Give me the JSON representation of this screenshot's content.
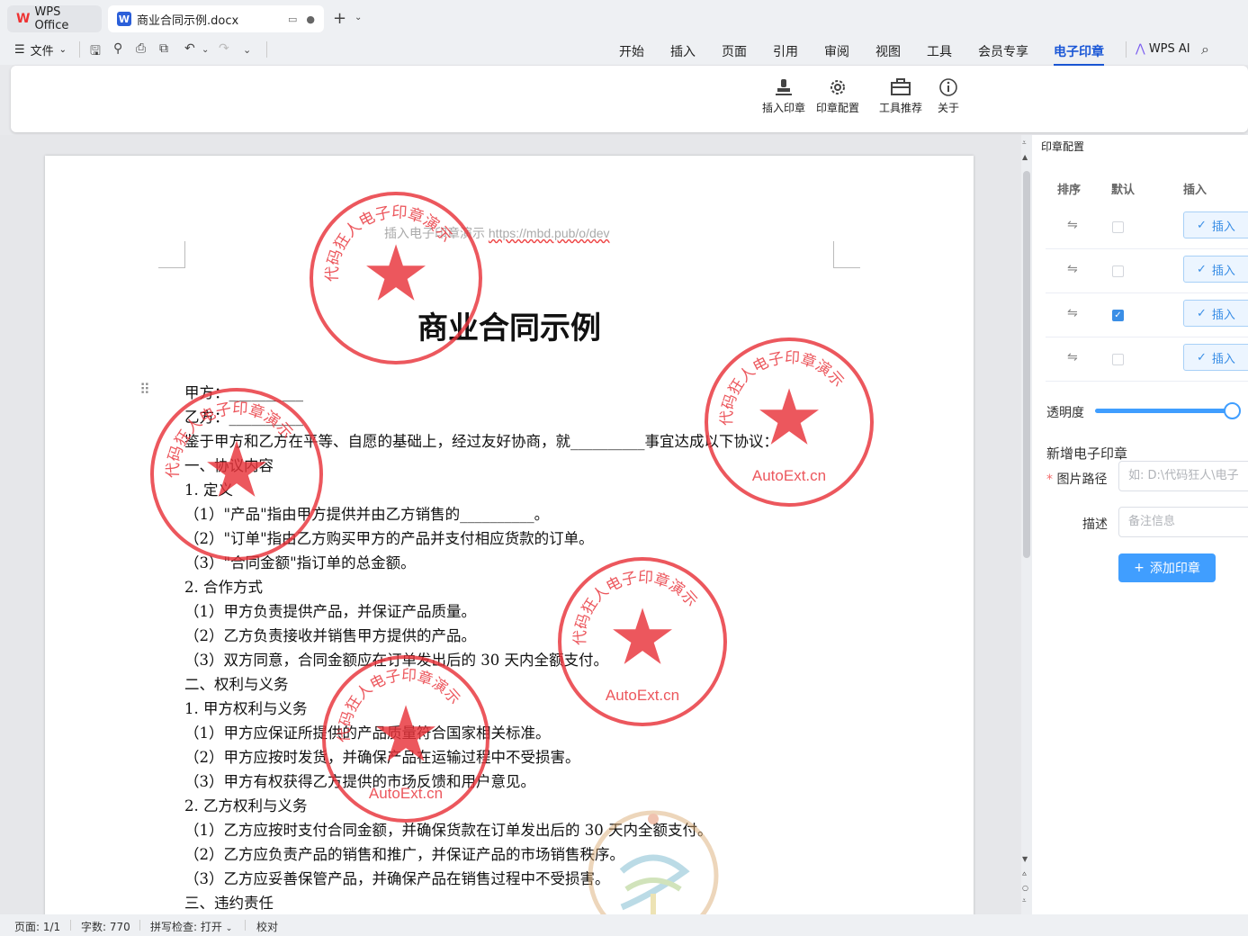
{
  "titlebar": {
    "app_tab": "WPS Office",
    "doc_tab": "商业合同示例.docx"
  },
  "menu": {
    "file": "文件"
  },
  "ribbon_tabs": [
    "开始",
    "插入",
    "页面",
    "引用",
    "审阅",
    "视图",
    "工具",
    "会员专享",
    "电子印章"
  ],
  "active_tab": "电子印章",
  "wps_ai": "WPS AI",
  "ribbon_buttons": {
    "insert_seal": "插入印章",
    "seal_config": "印章配置",
    "tool_recommend": "工具推荐",
    "about": "关于"
  },
  "document": {
    "header_text": "插入电子印章演示 ",
    "header_link": "https://mbd.pub/o/dev",
    "title": "商业合同示例",
    "lines": [
      "甲方：__________",
      "乙方：__________",
      "鉴于甲方和乙方在平等、自愿的基础上，经过友好协商，就__________事宜达成以下协议：",
      "一、协议内容",
      "1. 定义",
      "（1）\"产品\"指由甲方提供并由乙方销售的__________。",
      "（2）\"订单\"指由乙方购买甲方的产品并支付相应货款的订单。",
      "（3）\"合同金额\"指订单的总金额。",
      "2. 合作方式",
      "（1）甲方负责提供产品，并保证产品质量。",
      "（2）乙方负责接收并销售甲方提供的产品。",
      "（3）双方同意，合同金额应在订单发出后的 30 天内全额支付。",
      "二、权利与义务",
      "1. 甲方权利与义务",
      "（1）甲方应保证所提供的产品质量符合国家相关标准。",
      "（2）甲方应按时发货，并确保产品在运输过程中不受损害。",
      "（3）甲方有权获得乙方提供的市场反馈和用户意见。",
      "2. 乙方权利与义务",
      "（1）乙方应按时支付合同金额，并确保货款在订单发出后的 30 天内全额支付。",
      "（2）乙方应负责产品的销售和推广，并保证产品的市场销售秩序。",
      "（3）乙方应妥善保管产品，并确保产品在销售过程中不受损害。",
      "三、违约责任"
    ],
    "stamp_arc": "代码狂人电子印章演示",
    "stamp_bottom": "AutoExt.cn"
  },
  "side_panel": {
    "title": "印章配置",
    "col_sort": "排序",
    "col_default": "默认",
    "col_insert": "插入",
    "rows": [
      {
        "default": false
      },
      {
        "default": false
      },
      {
        "default": true
      },
      {
        "default": false
      }
    ],
    "insert_label": "插入",
    "opacity_label": "透明度",
    "opacity": 0.95,
    "new_section": "新增电子印章",
    "path_label": "图片路径",
    "path_placeholder": "如:  D:\\代码狂人\\电子",
    "desc_label": "描述",
    "desc_placeholder": "备注信息",
    "add_button": "添加印章"
  },
  "status": {
    "page": "页面: 1/1",
    "words": "字数: 770",
    "spell": "拼写检查: 打开",
    "proof": "校对"
  },
  "colors": {
    "accent": "#1a57d6",
    "stamp": "#e8333a",
    "button": "#409eff"
  }
}
